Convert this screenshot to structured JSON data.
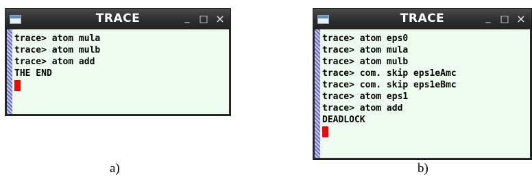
{
  "window_a": {
    "title": "TRACE",
    "controls": {
      "minimize": "_",
      "maximize": "□",
      "close": "×"
    },
    "lines": [
      "trace> atom mula",
      "trace> atom mulb",
      "trace> atom add",
      "THE END"
    ],
    "caption": "a)"
  },
  "window_b": {
    "title": "TRACE",
    "controls": {
      "minimize": "_",
      "maximize": "□",
      "close": "×"
    },
    "lines": [
      "trace> atom eps0",
      "trace> atom mula",
      "trace> atom mulb",
      "trace> com. skip eps1eAmc",
      "trace> com. skip eps1eBmc",
      "trace> atom eps1",
      "trace> atom add",
      "DEADLOCK"
    ],
    "caption": "b)"
  },
  "colors": {
    "terminal_bg": "#eefcef",
    "cursor": "#ff0000",
    "titlebar": "#2b2b2b"
  },
  "icons": {
    "app": "app-window-icon",
    "minimize": "minimize-icon",
    "maximize": "maximize-icon",
    "close": "close-icon"
  }
}
